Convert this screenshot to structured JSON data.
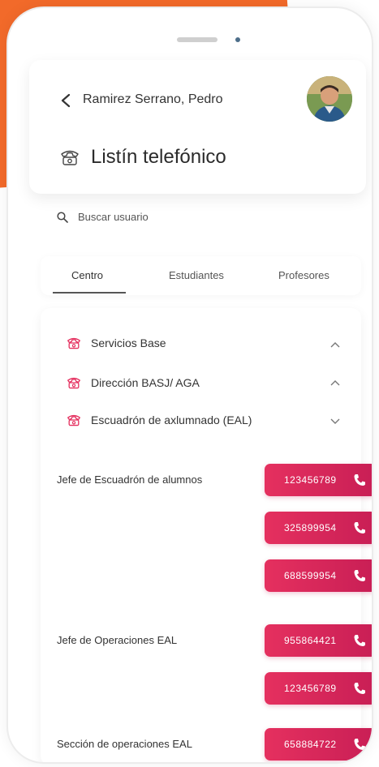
{
  "header": {
    "user_name": "Ramirez Serrano, Pedro",
    "title": "Listín telefónico"
  },
  "search": {
    "label": "Buscar usuario"
  },
  "tabs": [
    {
      "label": "Centro",
      "active": true
    },
    {
      "label": "Estudiantes",
      "active": false
    },
    {
      "label": "Profesores",
      "active": false
    }
  ],
  "sections": [
    {
      "label": "Servicios Base",
      "chevron": "up"
    },
    {
      "label": "Dirección BASJ/ AGA",
      "chevron": "up"
    },
    {
      "label": "Escuadrón de axlumnado (EAL)",
      "chevron": "down"
    }
  ],
  "contacts": [
    {
      "label": "Jefe de Escuadrón de alumnos",
      "numbers": [
        "123456789",
        "325899954",
        "688599954"
      ]
    },
    {
      "label": "Jefe de Operaciones EAL",
      "numbers": [
        "955864421",
        "123456789"
      ]
    },
    {
      "label": "Sección de operaciones EAL",
      "numbers": [
        "658884722"
      ]
    }
  ],
  "colors": {
    "accent": "#e5305f",
    "accent_dark": "#c81e55",
    "brand_orange": "#f26a2a"
  },
  "icons": {
    "back": "chevron-left-icon",
    "title": "telephone-icon",
    "search": "search-icon",
    "section": "telephone-icon",
    "call": "phone-call-icon"
  }
}
